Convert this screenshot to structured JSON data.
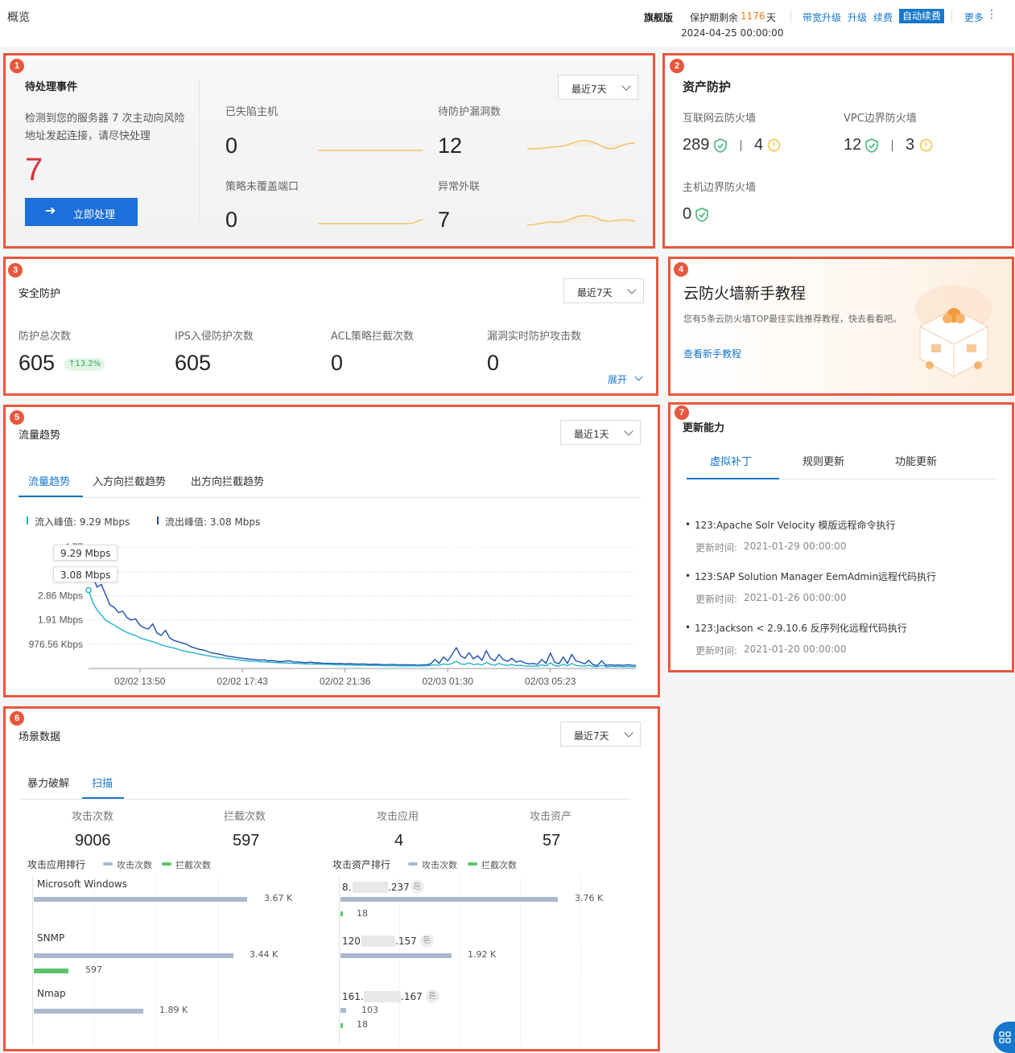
{
  "header": {
    "title": "概览",
    "edition": "旗舰版",
    "protect_prefix": "保护期剩余",
    "protect_days": "1176",
    "protect_suffix": "天",
    "expire_date": "2024-04-25 00:00:00",
    "links": [
      "带宽升级",
      "升级",
      "续费"
    ],
    "auto_renew": "自动续费",
    "more": "更多"
  },
  "badges": [
    "1",
    "2",
    "3",
    "4",
    "5",
    "6",
    "7"
  ],
  "pending": {
    "title": "待处理事件",
    "desc_line1": "检测到您的服务器 7 次主动向风险",
    "desc_line2": "地址发起连接，请尽快处理",
    "count": "7",
    "action": "立即处理",
    "range": "最近7天",
    "metrics": [
      {
        "label": "已失陷主机",
        "value": "0"
      },
      {
        "label": "待防护漏洞数",
        "value": "12"
      },
      {
        "label": "策略未覆盖端口",
        "value": "0"
      },
      {
        "label": "异常外联",
        "value": "7"
      }
    ]
  },
  "assets": {
    "title": "资产防护",
    "items": [
      {
        "label": "互联网云防火墙",
        "protected": "289",
        "warn": "4"
      },
      {
        "label": "VPC边界防火墙",
        "protected": "12",
        "warn": "3"
      },
      {
        "label": "主机边界防火墙",
        "protected": "0"
      }
    ]
  },
  "security": {
    "title": "安全防护",
    "range": "最近7天",
    "metrics": [
      {
        "label": "防护总次数",
        "value": "605",
        "delta": "↑13.2%"
      },
      {
        "label": "IPS入侵防护次数",
        "value": "605"
      },
      {
        "label": "ACL策略拦截次数",
        "value": "0"
      },
      {
        "label": "漏洞实时防护攻击数",
        "value": "0"
      }
    ],
    "expand": "展开"
  },
  "tutorial": {
    "title": "云防火墙新手教程",
    "desc": "您有5条云防火墙TOP最佳实践推荐教程，快去看看吧。",
    "link": "查看新手教程"
  },
  "traffic": {
    "title": "流量趋势",
    "range": "最近1天",
    "tabs": [
      "流量趋势",
      "入方向拦截趋势",
      "出方向拦截趋势"
    ],
    "active_tab": 0,
    "legend_in": "流入峰值: 9.29 Mbps",
    "legend_out": "流出峰值: 3.08 Mbps",
    "tooltip_in": "9.29 Mbps",
    "tooltip_out": "3.08 Mbps",
    "colors": {
      "in": "#1f4fb0",
      "out": "#22b3c9"
    }
  },
  "chart_data": {
    "type": "line",
    "title": "",
    "xlabel": "",
    "ylabel": "",
    "y_unit": "Mbps",
    "y_ticks": [
      "976.56 Kbps",
      "1.91 Mbps",
      "2.86 Mbps",
      "3.8",
      "4.77"
    ],
    "y_tick_values": [
      0.954,
      1.91,
      2.86,
      3.8,
      4.77
    ],
    "x_ticks": [
      "02/02 13:50",
      "02/02 17:43",
      "02/02 21:36",
      "02/03 01:30",
      "02/03 05:23"
    ],
    "x_tick_index": [
      12,
      36,
      60,
      84,
      108
    ],
    "ylim": [
      0,
      4.9
    ],
    "grid": true,
    "series": [
      {
        "name": "流入",
        "values": [
          3.9,
          3.6,
          3.2,
          3.3,
          2.9,
          2.5,
          2.4,
          2.2,
          2.25,
          2.0,
          1.9,
          1.95,
          1.7,
          1.6,
          1.55,
          1.75,
          1.4,
          1.3,
          1.5,
          1.2,
          1.1,
          1.05,
          1.0,
          0.95,
          0.85,
          0.8,
          0.75,
          0.72,
          0.66,
          0.6,
          0.58,
          0.55,
          0.5,
          0.47,
          0.45,
          0.42,
          0.4,
          0.38,
          0.36,
          0.35,
          0.33,
          0.34,
          0.3,
          0.31,
          0.28,
          0.27,
          0.29,
          0.3,
          0.25,
          0.26,
          0.24,
          0.23,
          0.25,
          0.22,
          0.22,
          0.2,
          0.21,
          0.2,
          0.19,
          0.2,
          0.18,
          0.19,
          0.18,
          0.17,
          0.18,
          0.17,
          0.16,
          0.17,
          0.16,
          0.15,
          0.15,
          0.16,
          0.15,
          0.14,
          0.15,
          0.14,
          0.15,
          0.13,
          0.14,
          0.15,
          0.18,
          0.35,
          0.2,
          0.45,
          0.3,
          0.55,
          0.82,
          0.5,
          0.4,
          0.62,
          0.38,
          0.5,
          0.32,
          0.7,
          0.4,
          0.3,
          0.55,
          0.35,
          0.28,
          0.4,
          0.25,
          0.3,
          0.22,
          0.18,
          0.2,
          0.16,
          0.35,
          0.2,
          0.6,
          0.25,
          0.18,
          0.45,
          0.2,
          0.55,
          0.3,
          0.25,
          0.18,
          0.32,
          0.15,
          0.12,
          0.3,
          0.12,
          0.15,
          0.13,
          0.14,
          0.12,
          0.15,
          0.13,
          0.12
        ]
      },
      {
        "name": "流出",
        "values": [
          3.08,
          2.6,
          2.3,
          2.1,
          1.9,
          1.8,
          1.7,
          1.6,
          1.5,
          1.42,
          1.35,
          1.3,
          1.2,
          1.15,
          1.1,
          1.05,
          1.0,
          0.93,
          0.88,
          0.84,
          0.8,
          0.75,
          0.7,
          0.67,
          0.63,
          0.6,
          0.56,
          0.53,
          0.5,
          0.47,
          0.44,
          0.42,
          0.4,
          0.38,
          0.36,
          0.34,
          0.32,
          0.3,
          0.29,
          0.28,
          0.27,
          0.26,
          0.25,
          0.24,
          0.23,
          0.22,
          0.22,
          0.21,
          0.2,
          0.2,
          0.19,
          0.18,
          0.18,
          0.17,
          0.17,
          0.16,
          0.16,
          0.15,
          0.15,
          0.14,
          0.14,
          0.14,
          0.13,
          0.13,
          0.13,
          0.12,
          0.12,
          0.12,
          0.12,
          0.11,
          0.11,
          0.11,
          0.11,
          0.1,
          0.1,
          0.1,
          0.1,
          0.1,
          0.1,
          0.11,
          0.12,
          0.15,
          0.12,
          0.18,
          0.15,
          0.2,
          0.28,
          0.18,
          0.16,
          0.22,
          0.15,
          0.18,
          0.14,
          0.24,
          0.16,
          0.13,
          0.2,
          0.14,
          0.12,
          0.16,
          0.11,
          0.13,
          0.1,
          0.09,
          0.1,
          0.09,
          0.15,
          0.1,
          0.22,
          0.11,
          0.09,
          0.17,
          0.1,
          0.2,
          0.12,
          0.1,
          0.09,
          0.13,
          0.08,
          0.07,
          0.12,
          0.07,
          0.08,
          0.08,
          0.08,
          0.07,
          0.08,
          0.07,
          0.07
        ]
      }
    ]
  },
  "scene": {
    "title": "场景数据",
    "range": "最近7天",
    "tabs": [
      "暴力破解",
      "扫描"
    ],
    "active_tab": 1,
    "stats": [
      {
        "label": "攻击次数",
        "value": "9006"
      },
      {
        "label": "拦截次数",
        "value": "597"
      },
      {
        "label": "攻击应用",
        "value": "4"
      },
      {
        "label": "攻击资产",
        "value": "57"
      }
    ],
    "app_rank_title": "攻击应用排行",
    "asset_rank_title": "攻击资产排行",
    "legend_attack": "攻击次数",
    "legend_block": "拦截次数",
    "colors": {
      "attack": "#a9b9cf",
      "block": "#5cc36b"
    },
    "app_rank": [
      {
        "name": "Microsoft Windows",
        "attack": 3.67,
        "attack_label": "3.67 K"
      },
      {
        "name": "SNMP",
        "attack": 3.44,
        "attack_label": "3.44 K",
        "block": 0.597,
        "block_label": "597"
      },
      {
        "name": "Nmap",
        "attack": 1.89,
        "attack_label": "1.89 K"
      }
    ],
    "asset_rank": [
      {
        "name_a": "8.",
        "name_b": ".237",
        "attack": 3.76,
        "attack_label": "3.76 K",
        "block": 0.018,
        "block_label": "18"
      },
      {
        "name_a": "120",
        "name_b": ".157",
        "attack": 1.92,
        "attack_label": "1.92 K"
      },
      {
        "name_a": "161.",
        "name_b": ".167",
        "attack": 0.103,
        "attack_label": "103",
        "block": 0.018,
        "block_label": "18"
      }
    ]
  },
  "updates": {
    "title": "更新能力",
    "tabs": [
      "虚拟补丁",
      "规则更新",
      "功能更新"
    ],
    "active_tab": 0,
    "time_prefix": "更新时间:",
    "items": [
      {
        "title": "123:Apache Solr Velocity 模版远程命令执行",
        "time": "2021-01-29 00:00:00"
      },
      {
        "title": "123:SAP Solution Manager EemAdmin远程代码执行",
        "time": "2021-01-26 00:00:00"
      },
      {
        "title": "123:Jackson < 2.9.10.6 反序列化远程代码执行",
        "time": "2021-01-20 00:00:00"
      }
    ]
  }
}
